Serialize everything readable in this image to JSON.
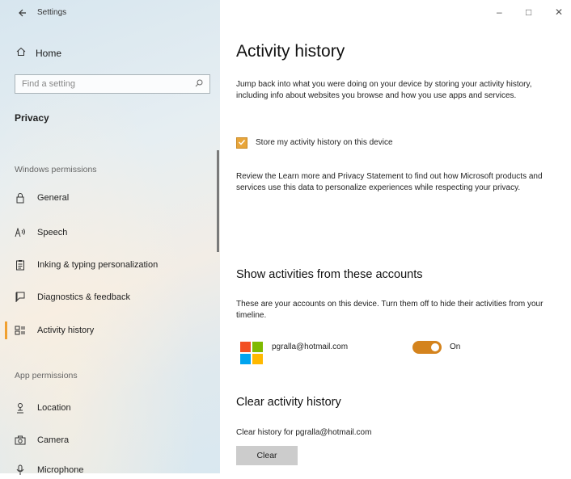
{
  "window": {
    "title": "Settings",
    "controls": {
      "minimize": "–",
      "maximize": "□",
      "close": "✕"
    }
  },
  "sidebar": {
    "home_label": "Home",
    "search_placeholder": "Find a setting",
    "category": "Privacy",
    "windows_permissions_label": "Windows permissions",
    "items": [
      {
        "label": "General",
        "icon": "lock-icon"
      },
      {
        "label": "Speech",
        "icon": "speech-icon"
      },
      {
        "label": "Inking & typing personalization",
        "icon": "clipboard-icon"
      },
      {
        "label": "Diagnostics & feedback",
        "icon": "feedback-icon"
      },
      {
        "label": "Activity history",
        "icon": "activity-history-icon",
        "selected": true
      }
    ],
    "app_permissions_label": "App permissions",
    "app_items": [
      {
        "label": "Location",
        "icon": "location-icon"
      },
      {
        "label": "Camera",
        "icon": "camera-icon"
      },
      {
        "label": "Microphone",
        "icon": "microphone-icon"
      }
    ]
  },
  "main": {
    "title": "Activity history",
    "intro": "Jump back into what you were doing on your device by storing your activity history, including info about websites you browse and how you use apps and services.",
    "store_checkbox_label": "Store my activity history on this device",
    "store_checkbox_checked": true,
    "privacy_text": "Review the Learn more and Privacy Statement to find out how Microsoft products and services use this data to personalize experiences while respecting your privacy.",
    "accounts_heading": "Show activities from these accounts",
    "accounts_text": "These are your accounts on this device. Turn them off to hide their activities from your timeline.",
    "account_email": "pgralla@hotmail.com",
    "toggle_label": "On",
    "toggle_on": true,
    "clear_heading": "Clear activity history",
    "clear_text": "Clear history for pgralla@hotmail.com",
    "clear_button": "Clear"
  },
  "colors": {
    "accent": "#d4831d",
    "ms_red": "#f25022",
    "ms_green": "#7fba00",
    "ms_blue": "#00a4ef",
    "ms_yellow": "#ffb900"
  }
}
